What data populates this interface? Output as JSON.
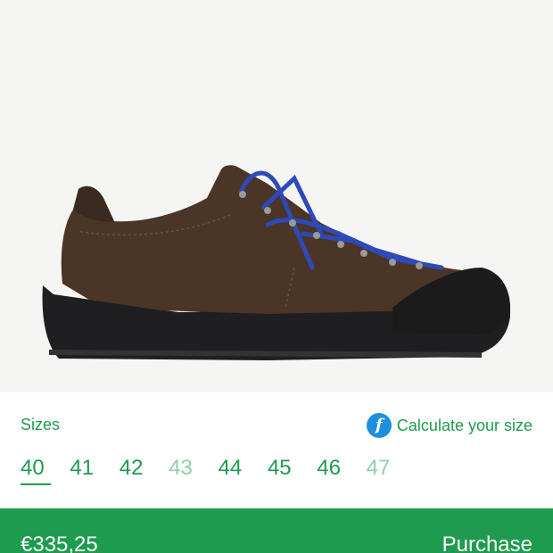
{
  "product": {
    "image": "brown-suede-hiking-shoe"
  },
  "sizes": {
    "label": "Sizes",
    "calculator": {
      "icon": "f-circle-icon",
      "label": "Calculate your size"
    },
    "options": [
      {
        "label": "40",
        "available": true,
        "selected": true
      },
      {
        "label": "41",
        "available": true,
        "selected": false
      },
      {
        "label": "42",
        "available": true,
        "selected": false
      },
      {
        "label": "43",
        "available": false,
        "selected": false
      },
      {
        "label": "44",
        "available": true,
        "selected": false
      },
      {
        "label": "45",
        "available": true,
        "selected": false
      },
      {
        "label": "46",
        "available": true,
        "selected": false
      },
      {
        "label": "47",
        "available": false,
        "selected": false
      }
    ]
  },
  "footer": {
    "price": "€335,25",
    "purchase_label": "Purchase"
  },
  "colors": {
    "accent": "#1e9b4e",
    "accent_muted": "#8ed0a9",
    "icon_blue": "#1d8fe0",
    "background": "#f5f5f3"
  }
}
